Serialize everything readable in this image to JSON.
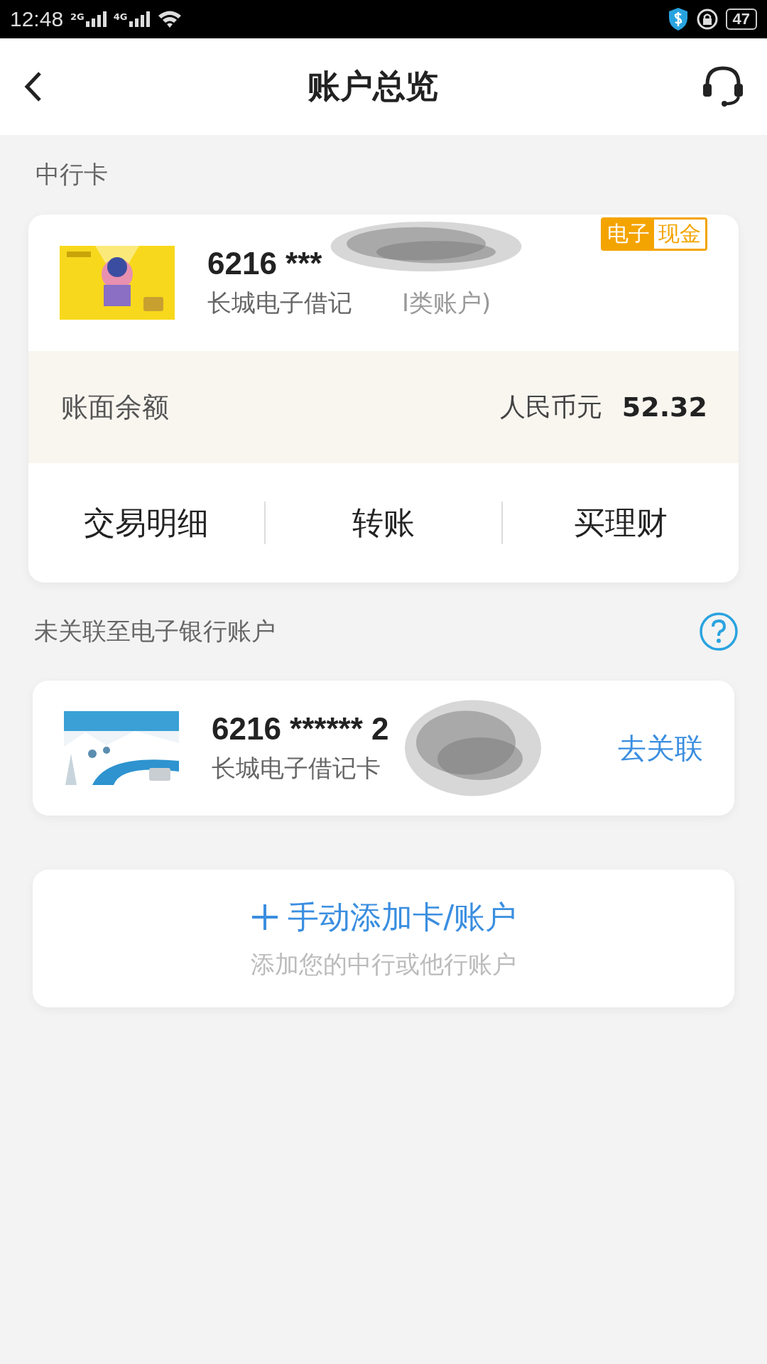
{
  "status_bar": {
    "time": "12:48",
    "signals": [
      "2G",
      "4G"
    ],
    "battery": "47"
  },
  "header": {
    "title": "账户总览"
  },
  "boc_section": {
    "label": "中行卡",
    "card": {
      "number": "6216 ***",
      "type_visible": "长城电子借记",
      "type_tail": "I类账户)",
      "badge": [
        "电子",
        "现金"
      ],
      "balance_label": "账面余额",
      "currency": "人民币元",
      "balance": "52.32",
      "actions": [
        "交易明细",
        "转账",
        "买理财"
      ]
    }
  },
  "unlinked_section": {
    "label": "未关联至电子银行账户",
    "card": {
      "number": "6216 ****** 2",
      "type": "长城电子借记卡",
      "link": "去关联"
    }
  },
  "add_card": {
    "title": "手动添加卡/账户",
    "subtitle": "添加您的中行或他行账户"
  }
}
